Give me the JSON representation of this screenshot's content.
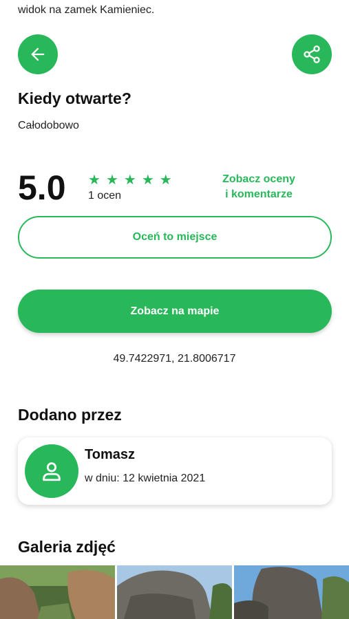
{
  "description_tail": "widok na zamek Kamieniec.",
  "nav": {
    "back_icon": "arrow-left-icon",
    "share_icon": "share-icon"
  },
  "hours": {
    "title": "Kiedy otwarte?",
    "value": "Całodobowo"
  },
  "rating": {
    "score": "5.0",
    "stars": 5,
    "count_text": "1 ocen",
    "see_ratings_line1": "Zobacz oceny",
    "see_ratings_line2": "i komentarze",
    "rate_button": "Oceń to miejsce"
  },
  "map": {
    "button": "Zobacz na mapie",
    "coordinates": "49.7422971, 21.8006717"
  },
  "added_by": {
    "title": "Dodano przez",
    "user_name": "Tomasz",
    "date_text": "w dniu: 12 kwietnia 2021",
    "avatar_icon": "person-icon"
  },
  "gallery": {
    "title": "Galeria zdjęć",
    "photo_count": 3
  },
  "colors": {
    "accent": "#28b85a",
    "text": "#111111",
    "background": "#ffffff"
  }
}
